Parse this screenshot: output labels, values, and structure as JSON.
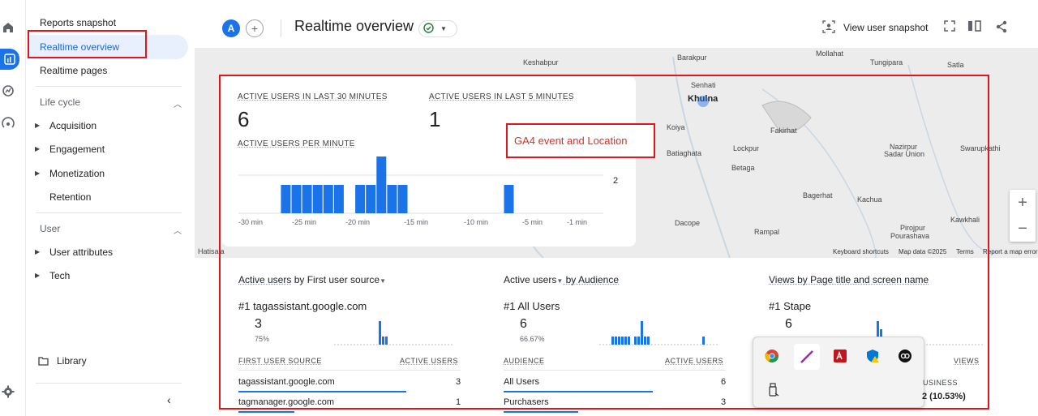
{
  "nav": {
    "reports_snapshot": "Reports snapshot",
    "realtime_overview": "Realtime overview",
    "realtime_pages": "Realtime pages",
    "lifecycle": "Life cycle",
    "acquisition": "Acquisition",
    "engagement": "Engagement",
    "monetization": "Monetization",
    "retention": "Retention",
    "user": "User",
    "user_attributes": "User attributes",
    "tech": "Tech",
    "library": "Library"
  },
  "header": {
    "avatar": "A",
    "title": "Realtime overview",
    "view_snapshot": "View user snapshot"
  },
  "map": {
    "labels": {
      "keshabpur": "Keshabpur",
      "barakpur": "Barakpur",
      "mollahat": "Mollahat",
      "tungipara": "Tungipara",
      "satla": "Satla",
      "senhati": "Senhati",
      "khulna": "Khulna",
      "koiya": "Koiya",
      "fakirhat": "Fakirhat",
      "batiaghata": "Batiaghata",
      "lockpur": "Lockpur",
      "betaga": "Betaga",
      "nazirpur": "Nazirpur",
      "sadar_union": "Sadar Union",
      "swarupkathi": "Swarupkathi",
      "bagerhat": "Bagerhat",
      "kachua": "Kachua",
      "dacope": "Dacope",
      "rampal": "Rampal",
      "kawkhali": "Kawkhali",
      "pirojpur": "Pirojpur",
      "pourashava": "Pourashava",
      "hatisala": "Hatisala"
    },
    "footer": {
      "shortcuts": "Keyboard shortcuts",
      "mapdata": "Map data ©2025",
      "terms": "Terms",
      "report": "Report a map error"
    }
  },
  "realtime": {
    "active30_label": "ACTIVE USERS IN LAST 30 MINUTES",
    "active30_value": "6",
    "active5_label": "ACTIVE USERS IN LAST 5 MINUTES",
    "active5_value": "1",
    "per_minute_label": "ACTIVE USERS PER MINUTE",
    "y_tick": "2"
  },
  "annotation": "GA4 event and Location",
  "card1": {
    "title_metric": "Active users",
    "title_rest": " by First user source",
    "top_label": "#1  tagassistant.google.com",
    "top_value": "3",
    "top_pct": "75%",
    "col1": "FIRST USER SOURCE",
    "col2": "ACTIVE USERS",
    "rows": [
      {
        "name": "tagassistant.google.com",
        "value": "3"
      },
      {
        "name": "tagmanager.google.com",
        "value": "1"
      }
    ]
  },
  "card2": {
    "title_metric": "Active users",
    "title_rest": " by Audience",
    "top_label": "#1  All Users",
    "top_value": "6",
    "top_pct": "66.67%",
    "col1": "AUDIENCE",
    "col2": "ACTIVE USERS",
    "rows": [
      {
        "name": "All Users",
        "value": "6"
      },
      {
        "name": "Purchasers",
        "value": "3"
      }
    ]
  },
  "card3": {
    "title": "Views by Page title and screen name",
    "top_label": "#1  Stape",
    "top_value": "6",
    "col2": "VIEWS",
    "biz_label": "USINESS",
    "biz_value": "2 (10.53%)"
  },
  "chart_data": {
    "type": "bar",
    "title": "ACTIVE USERS PER MINUTE",
    "x_ticks": [
      "-30 min",
      "-25 min",
      "-20 min",
      "-15 min",
      "-10 min",
      "-5 min",
      "-1 min"
    ],
    "x": [
      -30,
      -29,
      -28,
      -27,
      -26,
      -25,
      -24,
      -23,
      -22,
      -21,
      -20,
      -19,
      -18,
      -17,
      -16,
      -15,
      -14,
      -13,
      -12,
      -11,
      -10,
      -9,
      -8,
      -7,
      -6,
      -5,
      -4,
      -3,
      -2,
      -1
    ],
    "values": [
      0,
      0,
      0,
      0,
      1,
      1,
      1,
      1,
      1,
      1,
      0,
      1,
      1,
      2,
      1,
      1,
      0,
      0,
      0,
      0,
      0,
      0,
      0,
      0,
      0,
      1,
      0,
      0,
      0,
      0
    ],
    "ylim": [
      0,
      2
    ],
    "colors": {
      "bar": "#1a73e8"
    }
  }
}
